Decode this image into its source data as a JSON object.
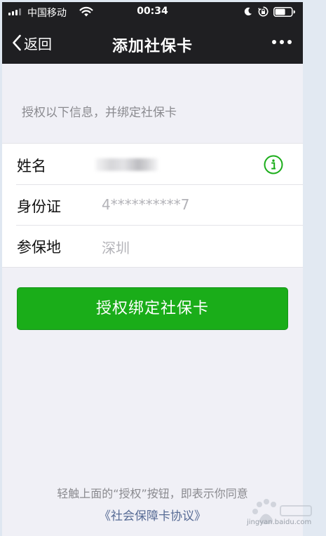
{
  "status_bar": {
    "carrier": "中国移动",
    "time": "00:34"
  },
  "nav": {
    "back_label": "返回",
    "title": "添加社保卡"
  },
  "hint": "授权以下信息，并绑定社保卡",
  "form": {
    "rows": [
      {
        "label": "姓名",
        "value": ""
      },
      {
        "label": "身份证",
        "value": "4**********7"
      },
      {
        "label": "参保地",
        "value": "深圳"
      }
    ]
  },
  "bind_button": "授权绑定社保卡",
  "footer": {
    "note": "轻触上面的“授权”按钮，即表示你同意",
    "agreement": "《社会保障卡协议》"
  },
  "colors": {
    "accent": "#1aad19",
    "link": "#576b95",
    "nav_bg": "#1f1f22"
  },
  "watermark": {
    "text": "jingyan.baidu.com"
  }
}
